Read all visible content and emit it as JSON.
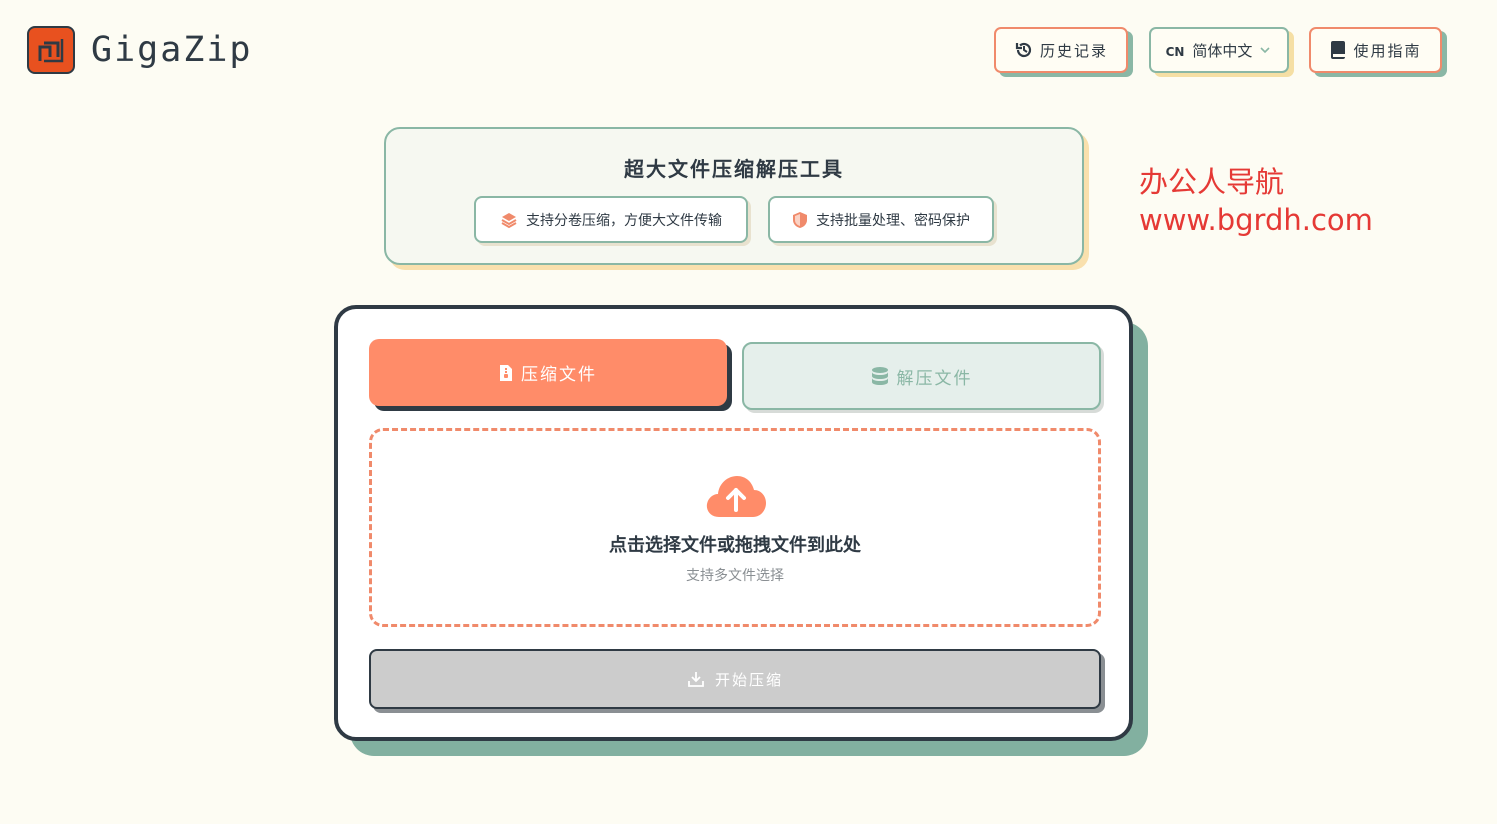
{
  "app": {
    "name": "GigaZip"
  },
  "header": {
    "history_label": "历史记录",
    "language_code": "CN",
    "language_label": "简体中文",
    "guide_label": "使用指南"
  },
  "intro": {
    "title": "超大文件压缩解压工具",
    "features": [
      {
        "icon": "layers-icon",
        "label": "支持分卷压缩，方便大文件传输"
      },
      {
        "icon": "shield-icon",
        "label": "支持批量处理、密码保护"
      }
    ]
  },
  "watermark": {
    "line1": "办公人导航",
    "line2": "www.bgrdh.com"
  },
  "tabs": [
    {
      "label": "压缩文件",
      "icon": "file-zip-icon",
      "active": true
    },
    {
      "label": "解压文件",
      "icon": "database-icon",
      "active": false
    }
  ],
  "dropzone": {
    "title": "点击选择文件或拖拽文件到此处",
    "subtitle": "支持多文件选择"
  },
  "start_button": {
    "label": "开始压缩"
  },
  "colors": {
    "accent": "#ff8c69",
    "teal": "#8ab7a5",
    "dark": "#2f3a44",
    "background": "#fdfcf3",
    "watermark": "#e53935"
  }
}
